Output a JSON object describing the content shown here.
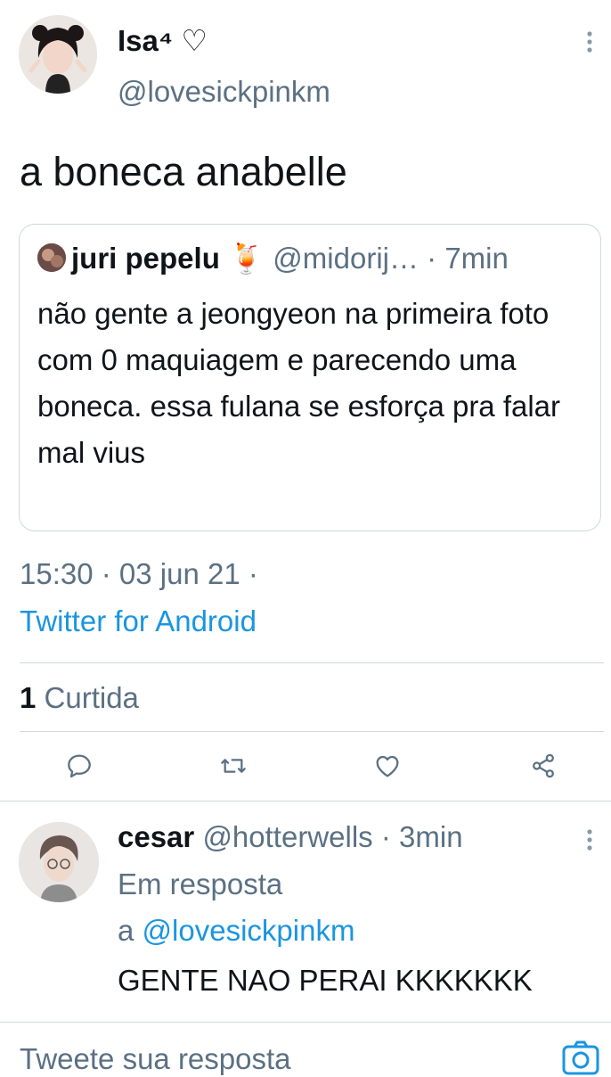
{
  "main_tweet": {
    "name": "Isa⁴",
    "heart_symbol": "♡",
    "handle": "@lovesickpinkm",
    "text": "a boneca anabelle"
  },
  "quoted_tweet": {
    "name": "juri pepelu",
    "emoji": "🍹",
    "handle": "@midorij…",
    "separator": "·",
    "time": "7min",
    "body": "não gente a jeongyeon na primeira foto com 0 maquiagem e parecendo uma boneca. essa fulana se esforça pra falar mal vius"
  },
  "meta": {
    "timestamp": "15:30 · 03 jun 21 ·",
    "source": "Twitter for Android"
  },
  "stats": {
    "likes_count": "1",
    "likes_label": "Curtida"
  },
  "actions": {
    "icons": [
      "reply-icon",
      "retweet-icon",
      "like-icon",
      "share-icon"
    ]
  },
  "reply": {
    "name": "cesar",
    "handle": "@hotterwells",
    "separator": "·",
    "time": "3min",
    "in_reply_prefix": "Em resposta",
    "in_reply_a": "a",
    "in_reply_handle": "@lovesickpinkm",
    "text": "GENTE NAO PERAI KKKKKKK"
  },
  "composer": {
    "placeholder": "Tweete sua resposta"
  },
  "colors": {
    "link": "#1b95e0",
    "muted": "#5b7083",
    "divider": "#cfd9de"
  }
}
